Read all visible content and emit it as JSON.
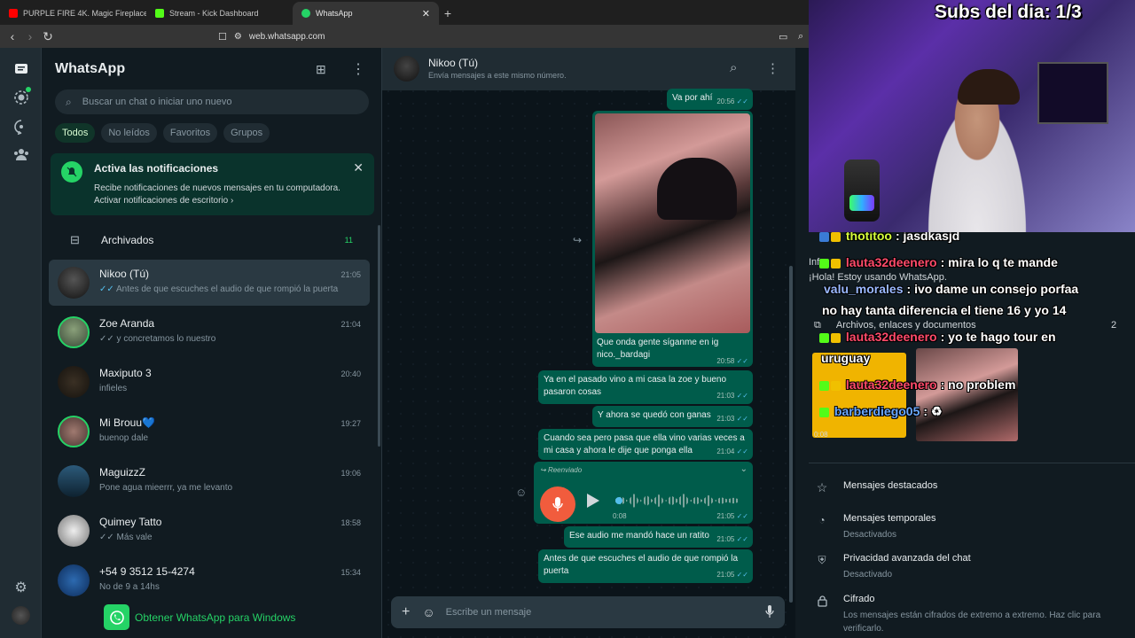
{
  "browser": {
    "tabs": [
      {
        "label": "PURPLE FIRE 4K. Magic Fireplace ·",
        "icon": "youtube-icon",
        "color": "#ff0000"
      },
      {
        "label": "Stream - Kick Dashboard",
        "icon": "kick-icon",
        "color": "#53fc18"
      },
      {
        "label": "WhatsApp",
        "icon": "whatsapp-icon",
        "color": "#25d366"
      }
    ],
    "url": "web.whatsapp.com"
  },
  "sidebar": {
    "title": "WhatsApp",
    "search_placeholder": "Buscar un chat o iniciar uno nuevo",
    "filters": [
      "Todos",
      "No leídos",
      "Favoritos",
      "Grupos"
    ],
    "notification": {
      "title": "Activa las notificaciones",
      "line1": "Recibe notificaciones de nuevos mensajes en tu computadora.",
      "line2": "Activar notificaciones de escritorio ›"
    },
    "archived": {
      "label": "Archivados",
      "count": "11"
    },
    "chats": [
      {
        "name": "Nikoo (Tú)",
        "time": "21:05",
        "ticks": "✓✓",
        "preview": "Antes de que escuches el audio de que rompió la puerta",
        "avatar": "#2b2b2b"
      },
      {
        "name": "Zoe Aranda",
        "time": "21:04",
        "ticks": "✓✓",
        "preview": "y concretamos lo nuestro",
        "avatar": "#4a6a4a"
      },
      {
        "name": "Maxiputo 3",
        "time": "20:40",
        "ticks": "",
        "preview": "infieles",
        "avatar": "#1c1a18"
      },
      {
        "name": "Mi Brouu💙",
        "time": "19:27",
        "ticks": "",
        "preview": "buenop dale",
        "avatar": "#7a5a55"
      },
      {
        "name": "MaguizzZ",
        "time": "19:06",
        "ticks": "",
        "preview": "Pone agua mieerrr, ya me levanto",
        "avatar": "#2c5a7a"
      },
      {
        "name": "Quimey Tatto",
        "time": "18:58",
        "ticks": "✓✓",
        "preview": "Más vale",
        "avatar": "#cfcfcf"
      },
      {
        "name": "+54 9 3512 15-4274",
        "time": "15:34",
        "ticks": "",
        "preview": "No de 9 a 14hs",
        "avatar": "#1a4c8a"
      }
    ],
    "get_app": "Obtener WhatsApp para Windows"
  },
  "conversation": {
    "name": "Nikoo (Tú)",
    "status": "Envía mensajes a este mismo número.",
    "messages": [
      {
        "text": "Va por ahí",
        "time": "20:56"
      },
      {
        "text": "Que onda gente síganme en ig nico._bardagi",
        "time": "20:58"
      },
      {
        "text": "Ya en el pasado vino a mi casa la zoe y bueno pasaron cosas",
        "time": "21:03"
      },
      {
        "text": "Y ahora se quedó con ganas",
        "time": "21:03"
      },
      {
        "text": "Cuando sea pero pasa que ella vino varias veces a mi casa y ahora le dije que ponga ella",
        "time": "21:04"
      },
      {
        "text": "Ese audio me mandó hace un ratito",
        "time": "21:05"
      },
      {
        "text": "Antes de que escuches el audio de que rompió la puerta",
        "time": "21:05"
      }
    ],
    "audio": {
      "forwarded": "Reenviado",
      "duration": "0:08",
      "time": "21:05"
    },
    "compose_placeholder": "Escribe un mensaje"
  },
  "overlay": {
    "subs": "Subs del dia: 1/3",
    "chat": [
      {
        "user": "thotitoo",
        "msg": "jasdkasjd",
        "color": "#d6ff3b"
      },
      {
        "user": "lauta32deenero",
        "msg": "mira lo q te mande",
        "color": "#ff4a6a"
      },
      {
        "user": "valu_morales",
        "msg": "ivo dame un consejo porfaa",
        "color": "#9ab8ff"
      },
      {
        "user": "",
        "msg": "no hay tanta diferencia el tiene 16 y yo 14",
        "color": "#ffffff"
      },
      {
        "user": "lauta32deenero",
        "msg": "yo te hago tour en",
        "color": "#ff4a6a"
      },
      {
        "user": "",
        "msg": "uruguay",
        "color": "#ffffff"
      },
      {
        "user": "lauta32deenero",
        "msg": "no problem",
        "color": "#ff4a6a"
      },
      {
        "user": "barberdiego05",
        "msg": "",
        "color": "#6aa8ff"
      }
    ],
    "underlying": {
      "info_label": "Info",
      "about": "¡Hola! Estoy usando WhatsApp.",
      "media": "Archivos, enlaces y documentos",
      "media_count": "2",
      "audio_duration": "0:08"
    }
  },
  "contact_info": {
    "starred": "Mensajes destacados",
    "temporal": {
      "title": "Mensajes temporales",
      "sub": "Desactivados"
    },
    "privacy": {
      "title": "Privacidad avanzada del chat",
      "sub": "Desactivado"
    },
    "encryption": {
      "title": "Cifrado",
      "sub": "Los mensajes están cifrados de extremo a extremo. Haz clic para verificarlo."
    }
  }
}
